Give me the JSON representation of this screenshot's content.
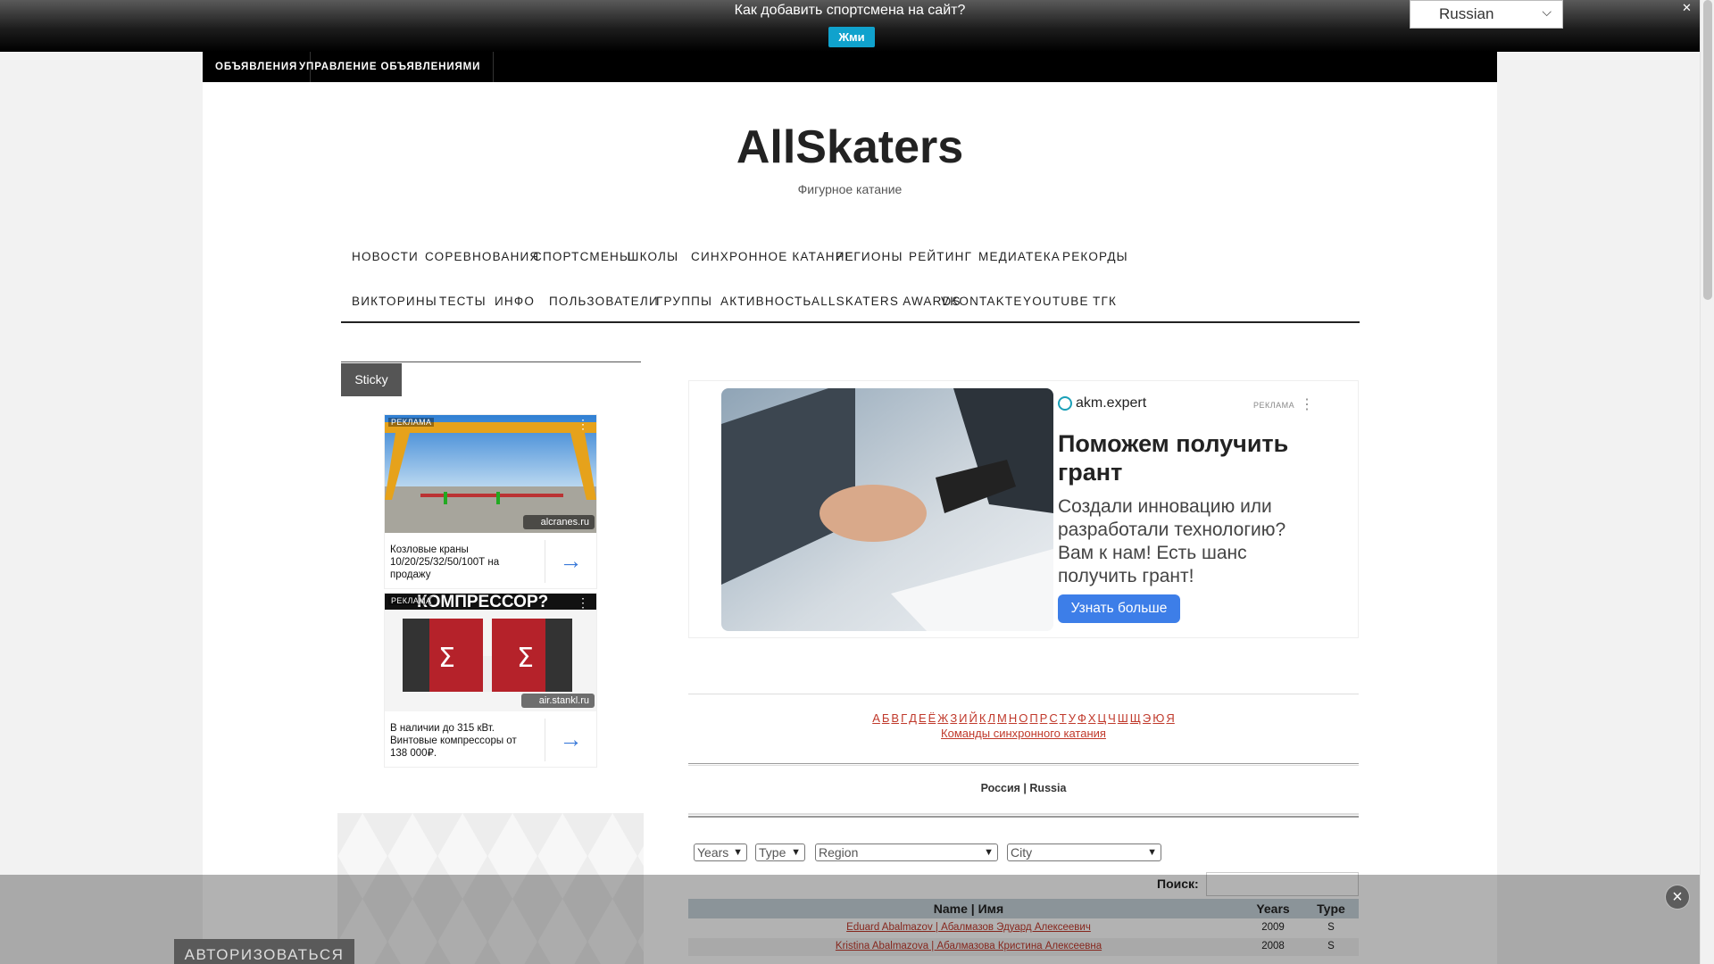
{
  "notification": {
    "question": "Как добавить спортсмена на сайт?",
    "button": "Жми",
    "close": "✕"
  },
  "language": {
    "selected": "Russian"
  },
  "adminbar": {
    "items": [
      "ОБЪЯВЛЕНИЯ",
      "УПРАВЛЕНИЕ ОБЪЯВЛЕНИЯМИ"
    ]
  },
  "site": {
    "title": "AllSkaters",
    "tagline": "Фигурное катание"
  },
  "nav": {
    "items": [
      "НОВОСТИ",
      "СОРЕВНОВАНИЯ",
      "СПОРТСМЕНЫ",
      "ШКОЛЫ",
      "СИНХРОННОЕ КАТАНИЕ",
      "РЕГИОНЫ",
      "РЕЙТИНГ",
      "МЕДИАТЕКА",
      "РЕКОРДЫ",
      "ВИКТОРИНЫ",
      "ТЕСТЫ",
      "ИНФО",
      "ПОЛЬЗОВАТЕЛИ",
      "ГРУППЫ",
      "АКТИВНОСТЬ",
      "ALLSKATERS AWARDS",
      "VKONTAKTE",
      "YOUTUBE",
      "ТГК"
    ]
  },
  "sidebar": {
    "sticky_label": "Sticky",
    "ads": [
      {
        "tag": "РЕКЛАМА",
        "domain": "alcranes.ru",
        "caption": "Козловые краны 10/20/25/32/50/100Т на продажу"
      },
      {
        "tag": "РЕКЛАМА",
        "domain": "air.stankl.ru",
        "caption": "В наличии до 315 кВт. Винтовые компрессоры от 138 000₽.",
        "image_text": "КОМПРЕССОР?"
      }
    ],
    "login_button": "АВТОРИЗОВАТЬСЯ"
  },
  "main_ad": {
    "brand": "akm.expert",
    "label": "РЕКЛАМА",
    "headline": "Поможем получить грант",
    "body": "Создали инновацию или разработали технологию? Вам к нам! Есть шанс получить грант!",
    "cta": "Узнать больше"
  },
  "alphabet": [
    "А",
    "Б",
    "В",
    "Г",
    "Д",
    "Е",
    "Ё",
    "Ж",
    "З",
    "И",
    "Й",
    "К",
    "Л",
    "М",
    "Н",
    "О",
    "П",
    "Р",
    "С",
    "Т",
    "У",
    "Ф",
    "Х",
    "Ц",
    "Ч",
    "Ш",
    "Щ",
    "Э",
    "Ю",
    "Я"
  ],
  "sync_link": "Команды синхронного катания",
  "country": "Россия | Russia",
  "filters": {
    "years": "Years",
    "type": "Type",
    "region": "Region",
    "city": "City"
  },
  "search": {
    "label": "Поиск:",
    "value": ""
  },
  "table": {
    "headers": {
      "name": "Name | Имя",
      "years": "Years",
      "type": "Type"
    },
    "rows": [
      {
        "name": "Eduard Abalmazov | Абалмазов Эдуард Алексеевич",
        "years": "2009",
        "type": "S"
      },
      {
        "name": "Kristina Abalmazova | Абалмазова Кристина Алексеевна",
        "years": "2008",
        "type": "S"
      }
    ]
  }
}
